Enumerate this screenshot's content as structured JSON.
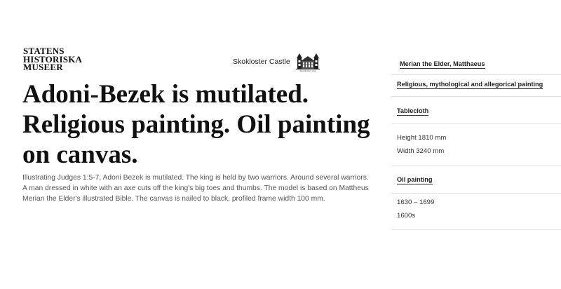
{
  "header": {
    "logo_lines": [
      "STATENS",
      "HISTORISKA",
      "MUSEER"
    ],
    "museum_name": "Skokloster Castle",
    "castle_icon_caption": "Skoklosters slott"
  },
  "object": {
    "title": "Adoni-Bezek is mutilated. Religious painting. Oil painting on canvas.",
    "description": "Illustrating Judges 1:5-7, Adoni Bezek is mutilated. The king is held by two warriors. Around several warriors. A man dressed in white with an axe cuts off the king's big toes and thumbs. The model is based on Mattheus Merian the Elder's illustrated Bible. The canvas is nailed to black, profiled frame width 100 mm."
  },
  "sidebar": {
    "artist_link": "Merian the Elder, Matthaeus",
    "category_link": "Religious, mythological and allegorical painting",
    "motif_link": "Tablecloth",
    "height": "Height 1810 mm",
    "width": "Width 3240 mm",
    "technique_link": "Oil painting",
    "date_range": "1630 – 1699",
    "century": "1600s"
  }
}
